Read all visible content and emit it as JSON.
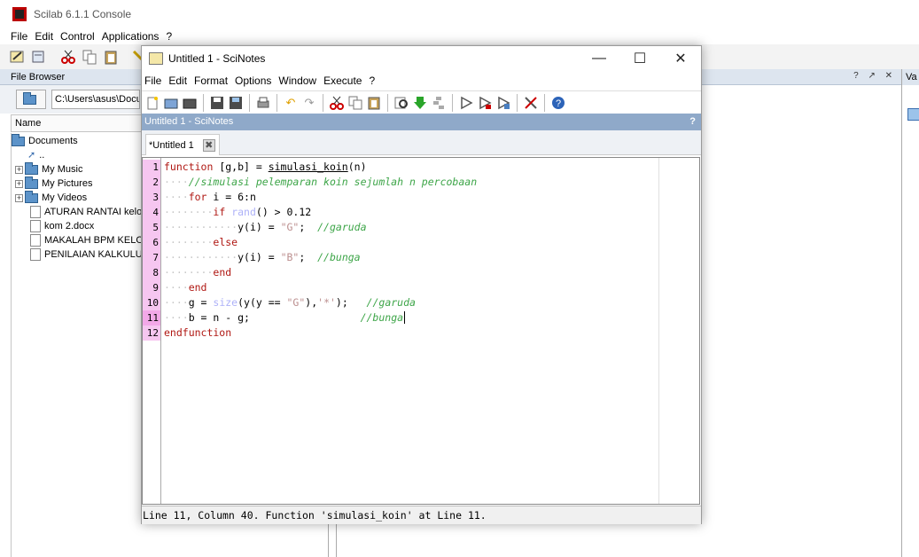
{
  "console": {
    "title": "Scilab 6.1.1 Console",
    "menu": [
      "File",
      "Edit",
      "Control",
      "Applications",
      "?"
    ]
  },
  "file_browser": {
    "header": "File Browser",
    "path": "C:\\Users\\asus\\Docu",
    "column_name": "Name",
    "root": "Documents",
    "up": "..",
    "items": [
      {
        "label": "My Music",
        "type": "folder"
      },
      {
        "label": "My Pictures",
        "type": "folder"
      },
      {
        "label": "My Videos",
        "type": "folder"
      },
      {
        "label": "ATURAN RANTAI kelor",
        "type": "file"
      },
      {
        "label": "kom 2.docx",
        "type": "file"
      },
      {
        "label": "MAKALAH BPM KELOMI",
        "type": "file"
      },
      {
        "label": "PENILAIAN KALKULUS",
        "type": "file"
      }
    ]
  },
  "variable_panel": {
    "header": "Va"
  },
  "scinotes": {
    "title": "Untitled 1 - SciNotes",
    "menu": [
      "File",
      "Edit",
      "Format",
      "Options",
      "Window",
      "Execute",
      "?"
    ],
    "docked_title": "Untitled 1 - SciNotes",
    "docked_help": "?",
    "tab_label": "*Untitled 1",
    "status": "Line 11, Column 40. Function 'simulasi_koin' at Line 11.",
    "line_numbers": [
      "1",
      "2",
      "3",
      "4",
      "5",
      "6",
      "7",
      "8",
      "9",
      "10",
      "11",
      "12"
    ],
    "code_lines": [
      "function [g,b] = simulasi_koin(n)",
      "    //simulasi pelemparan koin sejumlah n percobaan",
      "    for i = 6:n",
      "        if rand() > 0.12",
      "            y(i) = \"G\";  //garuda",
      "        else",
      "            y(i) = \"B\";  //bunga",
      "        end",
      "    end",
      "    g = size(y(y == \"G\"),'*');   //garuda",
      "    b = n - g;                  //bunga",
      "endfunction"
    ]
  },
  "colors": {
    "gutter": "#f6c6f0",
    "keyword": "#b01813",
    "comment": "#3da548",
    "docked_bar": "#8fa9c9"
  }
}
